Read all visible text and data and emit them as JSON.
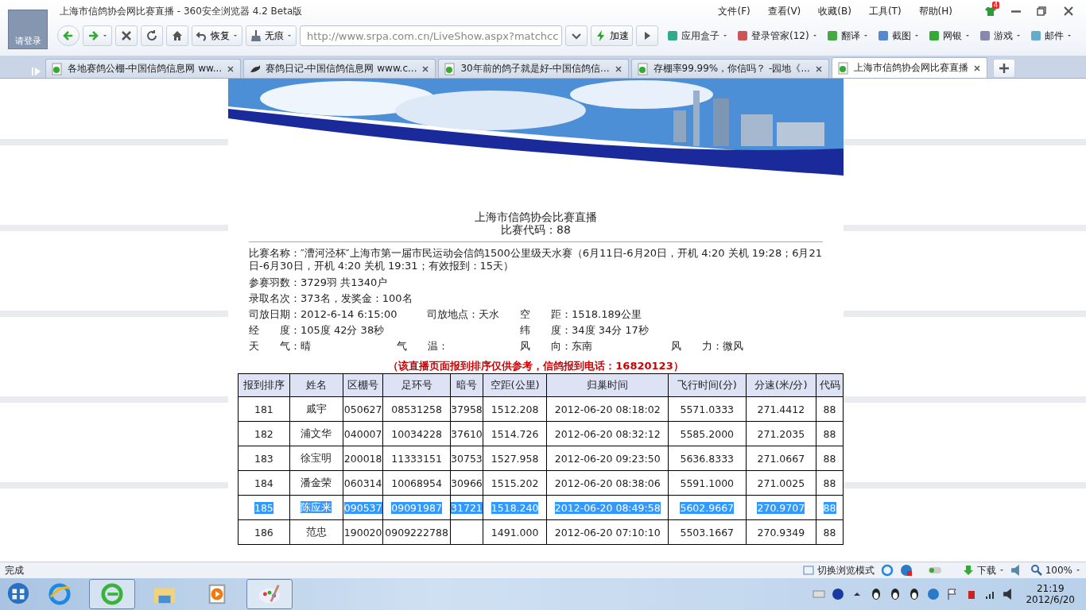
{
  "window": {
    "title": "上海市信鸽协会网比赛直播 - 360安全浏览器 4.2 Beta版",
    "login": "请登录",
    "badge": "4"
  },
  "menu": [
    "文件(F)",
    "查看(V)",
    "收藏(B)",
    "工具(T)",
    "帮助(H)"
  ],
  "toolbar": {
    "restore": "恢复",
    "incognito": "无痕",
    "url": "http://www.srpa.com.cn/LiveShow.aspx?matchcc",
    "speed": "加速",
    "tools": [
      "应用盒子",
      "登录管家(12)",
      "翻译",
      "截图",
      "网银",
      "游戏",
      "邮件"
    ]
  },
  "tabs": [
    {
      "label": "各地赛鸽公棚-中国信鸽信息网 ww...",
      "selected": false
    },
    {
      "label": "赛鸽日记-中国信鸽信息网 www.c...",
      "selected": false
    },
    {
      "label": "30年前的鸽子就是好-中国信鸽信...",
      "selected": false
    },
    {
      "label": "存棚率99.99%，你信吗？ -园地《...",
      "selected": false
    },
    {
      "label": "上海市信鸽协会网比赛直播",
      "selected": true
    }
  ],
  "page": {
    "title": "上海市信鸽协会比赛直播",
    "code": "比赛代码：88",
    "race_name": "比赛名称：″漕河泾杯″上海市第一届市民运动会信鸽1500公里级天水赛（6月11日-6月20日，开机 4:20 关机 19:28；6月21日-6月30日，开机 4:20 关机 19:31；有效报到：15天）",
    "info_lines": [
      [
        "参赛羽数：3729羽 共1340户"
      ],
      [
        "录取名次：373名，发奖金：100名"
      ],
      [
        "司放日期：2012-6-14 6:15:00",
        "司放地点：天水",
        "空　　距：1518.189公里"
      ],
      [
        "经　　度：105度 42分 38秒",
        "纬　　度：34度 34分 17秒"
      ],
      [
        "天　　气：晴",
        "气　　温：",
        "风　　向：东南",
        "风　　力：微风"
      ]
    ],
    "notice": "（该直播页面报到排序仅供参考，信鸽报到电话：16820123）"
  },
  "table": {
    "columns": [
      "报到排序",
      "姓名",
      "区棚号",
      "足环号",
      "暗号",
      "空距(公里)",
      "归巢时间",
      "飞行时间(分)",
      "分速(米/分)",
      "代码"
    ],
    "rows": [
      {
        "cells": [
          "181",
          "戚宇",
          "050627",
          "08531258",
          "37958",
          "1512.208",
          "2012-06-20 08:18:02",
          "5571.0333",
          "271.4412",
          "88"
        ],
        "selected": false
      },
      {
        "cells": [
          "182",
          "浦文华",
          "040007",
          "10034228",
          "37610",
          "1514.726",
          "2012-06-20 08:32:12",
          "5585.2000",
          "271.2035",
          "88"
        ],
        "selected": false
      },
      {
        "cells": [
          "183",
          "徐宝明",
          "200018",
          "11333151",
          "30753",
          "1527.958",
          "2012-06-20 09:23:50",
          "5636.8333",
          "271.0667",
          "88"
        ],
        "selected": false
      },
      {
        "cells": [
          "184",
          "潘金荣",
          "060314",
          "10068954",
          "30966",
          "1515.202",
          "2012-06-20 08:38:06",
          "5591.1000",
          "271.0025",
          "88"
        ],
        "selected": false
      },
      {
        "cells": [
          "185",
          "陈应来",
          "090537",
          "09091987",
          "31721",
          "1518.240",
          "2012-06-20 08:49:58",
          "5602.9667",
          "270.9707",
          "88"
        ],
        "selected": true
      },
      {
        "cells": [
          "186",
          "范忠",
          "190020",
          "0909222788",
          "",
          "1491.000",
          "2012-06-20 07:10:10",
          "5503.1667",
          "270.9349",
          "88"
        ],
        "selected": false
      }
    ]
  },
  "status": {
    "text": "完成",
    "mode": "切换浏览模式",
    "download": "下载",
    "zoom": "100%"
  },
  "taskbar": {
    "apps": [
      {
        "selected": false
      },
      {
        "selected": true
      },
      {
        "selected": false
      },
      {
        "selected": false
      },
      {
        "selected": true
      }
    ],
    "time": "21:19",
    "date": "2012/6/20"
  }
}
